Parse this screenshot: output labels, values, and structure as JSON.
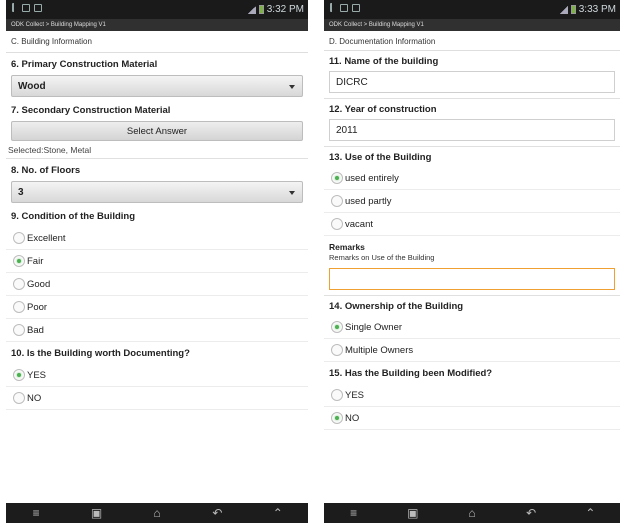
{
  "left": {
    "status_time": "3:32 PM",
    "app_title": "ODK Collect > Building Mapping V1",
    "section": "C. Building Information",
    "q6": {
      "label": "6. Primary Construction Material",
      "value": "Wood"
    },
    "q7": {
      "label": "7. Secondary Construction Material",
      "button": "Select Answer",
      "selected": "Selected:Stone, Metal"
    },
    "q8": {
      "label": "8. No. of Floors",
      "value": "3"
    },
    "q9": {
      "label": "9. Condition of the Building",
      "options": [
        "Excellent",
        "Fair",
        "Good",
        "Poor",
        "Bad"
      ],
      "selected": "Fair"
    },
    "q10": {
      "label": "10. Is the Building worth Documenting?",
      "options": [
        "YES",
        "NO"
      ],
      "selected": "YES"
    }
  },
  "right": {
    "status_time": "3:33 PM",
    "app_title": "ODK Collect > Building Mapping V1",
    "section": "D. Documentation Information",
    "q11": {
      "label": "11. Name of the building",
      "value": "DICRC"
    },
    "q12": {
      "label": "12. Year of construction",
      "value": "2011"
    },
    "q13": {
      "label": "13. Use of the Building",
      "options": [
        "used entirely",
        "used partly",
        "vacant"
      ],
      "selected": "used entirely"
    },
    "remarks": {
      "label": "Remarks",
      "hint": "Remarks on Use of the Building",
      "value": ""
    },
    "q14": {
      "label": "14. Ownership of the Building",
      "options": [
        "Single Owner",
        "Multiple Owners"
      ],
      "selected": "Single Owner"
    },
    "q15": {
      "label": "15. Has the Building been Modified?",
      "options": [
        "YES",
        "NO"
      ],
      "selected": "NO"
    }
  },
  "icons": {
    "status_left": [
      "usb-icon",
      "image-icon",
      "mail-icon"
    ],
    "status_right": [
      "signal-icon",
      "battery-icon"
    ],
    "nav": [
      "menu-icon",
      "recent-apps-icon",
      "home-icon",
      "back-icon",
      "up-icon"
    ]
  },
  "colors": {
    "radio_selected": "#4caf50",
    "focus_border": "#f0a030",
    "statusbar": "#1a1a1a"
  }
}
